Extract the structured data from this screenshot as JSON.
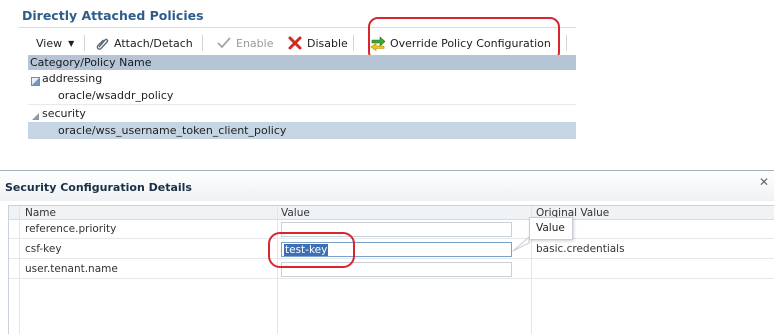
{
  "policies_panel": {
    "title": "Directly Attached Policies",
    "toolbar": {
      "view_label": "View",
      "attach_detach_label": "Attach/Detach",
      "enable_label": "Enable",
      "disable_label": "Disable",
      "override_label": "Override Policy Configuration"
    },
    "tree": {
      "header": "Category/Policy Name",
      "rows": [
        {
          "label": "addressing",
          "type": "category",
          "expanded": true,
          "selected": false
        },
        {
          "label": "oracle/wsaddr_policy",
          "type": "policy",
          "selected": false
        },
        {
          "label": "security",
          "type": "category",
          "expanded": true,
          "selected": false
        },
        {
          "label": "oracle/wss_username_token_client_policy",
          "type": "policy",
          "selected": true
        }
      ]
    }
  },
  "dialog": {
    "title": "Security Configuration Details",
    "close_icon": "close-icon",
    "columns": {
      "name": "Name",
      "value": "Value",
      "original": "Original Value"
    },
    "rows": [
      {
        "name": "reference.priority",
        "value": "",
        "original": ""
      },
      {
        "name": "csf-key",
        "value": "test-key",
        "original": "basic.credentials"
      },
      {
        "name": "user.tenant.name",
        "value": "",
        "original": ""
      }
    ],
    "tooltip": "Value"
  },
  "colors": {
    "title_blue": "#2e5d8c",
    "highlight_red": "#d9262c",
    "selection_blue": "#3f6fb3",
    "tree_header": "#b5c5d6",
    "selected_row": "#c6d5e3"
  }
}
